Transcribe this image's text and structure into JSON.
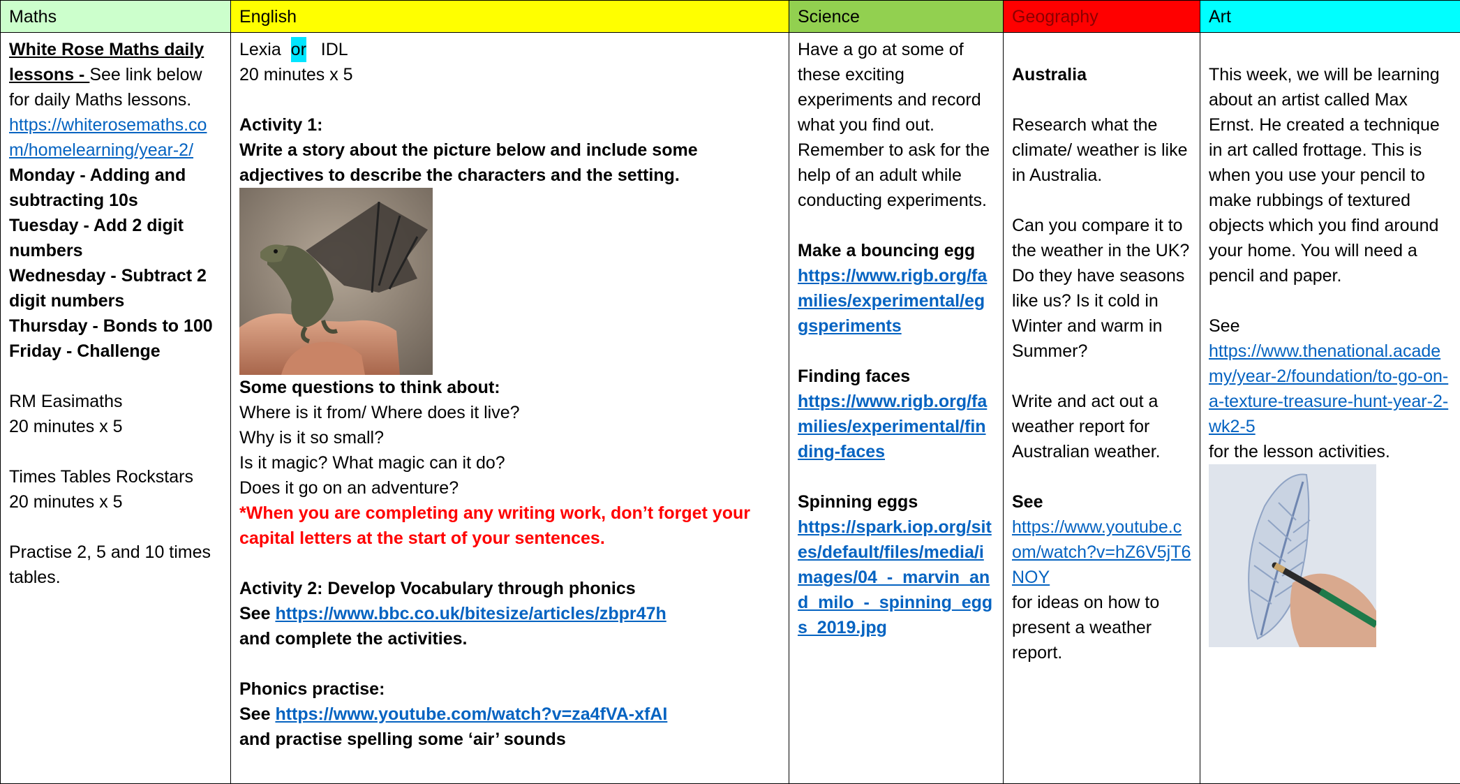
{
  "headers": {
    "maths": "Maths",
    "english": "English",
    "science": "Science",
    "geography": "Geography",
    "art": "Art"
  },
  "maths": {
    "heading_bold": "White Rose Maths daily lessons - ",
    "heading_rest": "See link below for daily Maths lessons.",
    "link": "https://whiterosemaths.com/homelearning/year-2/",
    "days": [
      "Monday - Adding and subtracting 10s",
      "Tuesday - Add 2 digit numbers",
      "Wednesday - Subtract 2 digit numbers",
      "Thursday - Bonds to 100",
      "Friday - Challenge"
    ],
    "easimaths": "RM Easimaths",
    "easimaths_time": "20 minutes x 5",
    "rockstars": "Times Tables Rockstars",
    "rockstars_time": "20 minutes x 5",
    "practise": "Practise 2, 5 and 10 times tables."
  },
  "english": {
    "lexia": "Lexia",
    "or": "or",
    "idl": "IDL",
    "time": "20 minutes x 5",
    "activity1_title": "Activity 1:",
    "activity1_text": "Write a story about the picture below and include some adjectives to describe the characters and the setting.",
    "questions_title": "Some questions to think about:",
    "questions": [
      "Where is it from/ Where does it live?",
      "Why is it so small?",
      "Is it magic? What magic can it do?",
      "Does it go on an adventure?"
    ],
    "reminder": "*When you are completing any writing work, don’t forget your capital letters at the start of your sentences.",
    "activity2_title": "Activity 2: Develop Vocabulary through phonics",
    "see": "See ",
    "activity2_link": "https://www.bbc.co.uk/bitesize/articles/zbpr47h",
    "activity2_after": "and complete the activities.",
    "phonics_title": "Phonics practise:",
    "phonics_link": "https://www.youtube.com/watch?v=za4fVA-xfAI",
    "phonics_after": "and practise spelling some ‘air’ sounds"
  },
  "science": {
    "intro": "Have a go at some of these exciting experiments and record what you find out.",
    "reminder": "Remember to ask for the help of an adult while conducting experiments.",
    "experiments": [
      {
        "title": "Make a bouncing egg",
        "link": "https://www.rigb.org/families/experimental/eggsperiments"
      },
      {
        "title": "Finding faces",
        "link": "https://www.rigb.org/families/experimental/finding-faces"
      },
      {
        "title": "Spinning eggs",
        "link": "https://spark.iop.org/sites/default/files/media/images/04_-_marvin_and_milo_-_spinning_eggs_2019.jpg"
      }
    ]
  },
  "geography": {
    "topic": "Australia",
    "research": "Research what the climate/ weather is like in Australia.",
    "compare": "Can you compare it to the weather in the UK?",
    "seasons": "Do they have seasons like us? Is it cold in Winter and warm in Summer?",
    "report": "Write and act out a weather report for Australian weather.",
    "see": "See",
    "link": "https://www.youtube.com/watch?v=hZ6V5jT6NOY",
    "after": "for ideas on how to present a weather report."
  },
  "art": {
    "intro": "This week, we will be learning about an artist called Max Ernst. He created a technique in art called frottage. This is when you use your pencil to make rubbings of textured objects which you find around your home. You will need a pencil and paper.",
    "see": "See",
    "link": "https://www.thenational.academy/year-2/foundation/to-go-on-a-texture-treasure-hunt-year-2-wk2-5",
    "after": "for the lesson activities."
  },
  "colors": {
    "maths_header": "#ccffcc",
    "english_header": "#ffff00",
    "science_header": "#92d050",
    "geography_header": "#ff0000",
    "art_header": "#00ffff",
    "link": "#0563c1",
    "reminder": "#ff0000"
  }
}
